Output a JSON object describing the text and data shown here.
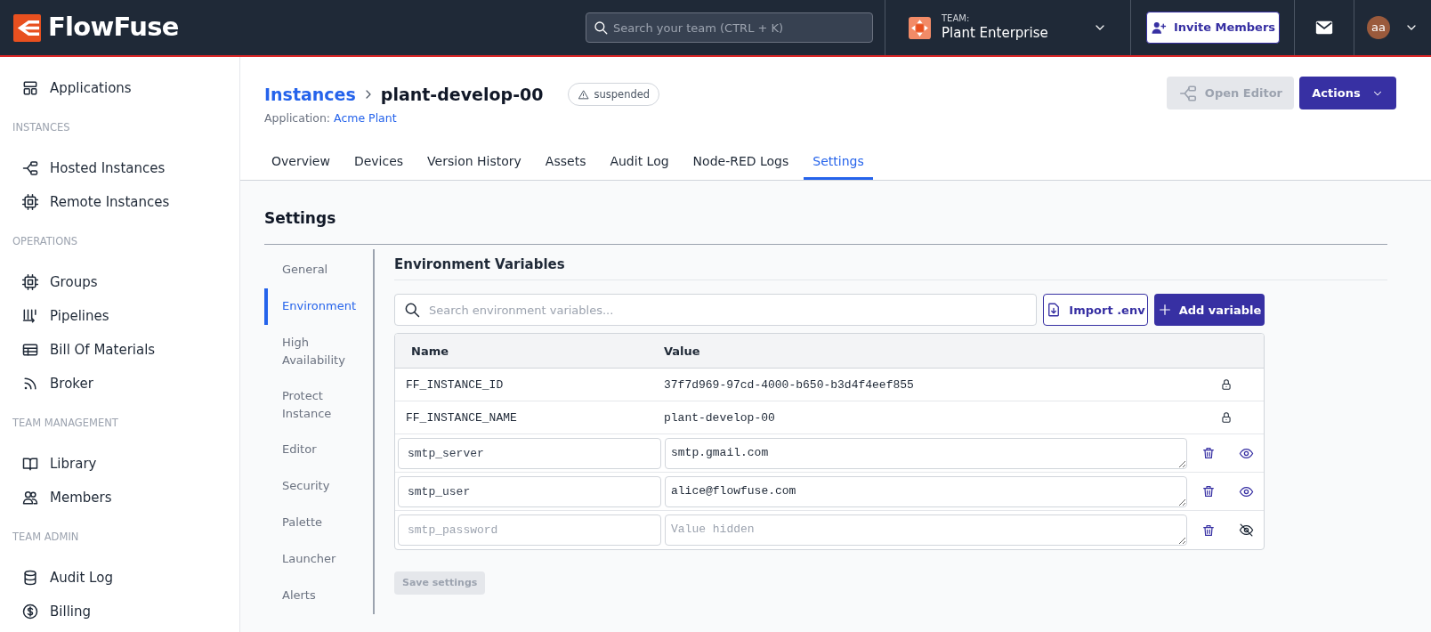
{
  "topbar": {
    "logo": "FlowFuse",
    "search": {
      "placeholder": "Search your team (CTRL + K)"
    },
    "team": {
      "label": "TEAM:",
      "name": "Plant Enterprise"
    },
    "invite_button": "Invite Members",
    "avatar": "aa"
  },
  "sidebar": {
    "sections": [
      {
        "items": [
          {
            "label": "Applications"
          }
        ]
      },
      {
        "title": "INSTANCES",
        "items": [
          {
            "label": "Hosted Instances"
          },
          {
            "label": "Remote Instances"
          }
        ]
      },
      {
        "title": "OPERATIONS",
        "items": [
          {
            "label": "Groups"
          },
          {
            "label": "Pipelines"
          },
          {
            "label": "Bill Of Materials"
          },
          {
            "label": "Broker"
          }
        ]
      },
      {
        "title": "TEAM MANAGEMENT",
        "items": [
          {
            "label": "Library"
          },
          {
            "label": "Members"
          }
        ]
      },
      {
        "title": "TEAM ADMIN",
        "items": [
          {
            "label": "Audit Log"
          },
          {
            "label": "Billing"
          }
        ]
      }
    ]
  },
  "header": {
    "breadcrumb": "Instances",
    "instance": "plant-develop-00",
    "status": "suspended",
    "application_label": "Application:",
    "application": "Acme Plant",
    "open_editor": {
      "label": "Open Editor",
      "disabled": true
    },
    "actions": "Actions"
  },
  "tabs": [
    {
      "label": "Overview",
      "selected": false
    },
    {
      "label": "Devices",
      "selected": false
    },
    {
      "label": "Version History",
      "selected": false
    },
    {
      "label": "Assets",
      "selected": false
    },
    {
      "label": "Audit Log",
      "selected": false
    },
    {
      "label": "Node-RED Logs",
      "selected": false
    },
    {
      "label": "Settings",
      "selected": true
    }
  ],
  "settings": {
    "title": "Settings",
    "nav": [
      {
        "label": "General",
        "selected": false
      },
      {
        "label": "Environment",
        "selected": true
      },
      {
        "label": "High Availability",
        "selected": false
      },
      {
        "label": "Protect Instance",
        "selected": false
      },
      {
        "label": "Editor",
        "selected": false
      },
      {
        "label": "Security",
        "selected": false
      },
      {
        "label": "Palette",
        "selected": false
      },
      {
        "label": "Launcher",
        "selected": false
      },
      {
        "label": "Alerts",
        "selected": false
      }
    ]
  },
  "env": {
    "title": "Environment Variables",
    "search": {
      "placeholder": "Search environment variables..."
    },
    "import_button": "Import .env",
    "add_button": "Add variable",
    "columns": [
      "Name",
      "Value"
    ],
    "rows": [
      {
        "kind": "locked",
        "name": "FF_INSTANCE_ID",
        "value": "37f7d969-97cd-4000-b650-b3d4f4eef855"
      },
      {
        "kind": "locked",
        "name": "FF_INSTANCE_NAME",
        "value": "plant-develop-00"
      },
      {
        "kind": "editable",
        "name": "smtp_server",
        "value": "smtp.gmail.com",
        "hidden": false
      },
      {
        "kind": "editable",
        "name": "smtp_user",
        "value": "alice@flowfuse.com",
        "hidden": false
      },
      {
        "kind": "editable",
        "name": "smtp_password",
        "value_placeholder": "Value hidden",
        "hidden": true
      }
    ],
    "save_button": {
      "label": "Save settings",
      "disabled": true
    }
  }
}
